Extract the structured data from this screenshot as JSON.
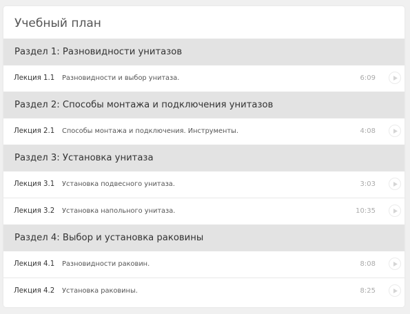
{
  "curriculum": {
    "title": "Учебный план",
    "sections": [
      {
        "title": "Раздел 1: Разновидности унитазов",
        "lectures": [
          {
            "number": "Лекция 1.1",
            "title": "Разновидности и выбор унитаза.",
            "duration": "6:09"
          }
        ]
      },
      {
        "title": "Раздел 2: Способы монтажа и подключения унитазов",
        "lectures": [
          {
            "number": "Лекция 2.1",
            "title": "Способы монтажа и подключения. Инструменты.",
            "duration": "4:08"
          }
        ]
      },
      {
        "title": "Раздел 3: Установка унитаза",
        "lectures": [
          {
            "number": "Лекция 3.1",
            "title": "Установка подвесного унитаза.",
            "duration": "3:03"
          },
          {
            "number": "Лекция 3.2",
            "title": "Установка напольного унитаза.",
            "duration": "10:35"
          }
        ]
      },
      {
        "title": "Раздел 4: Выбор и установка раковины",
        "lectures": [
          {
            "number": "Лекция 4.1",
            "title": "Разновидности раковин.",
            "duration": "8:08"
          },
          {
            "number": "Лекция 4.2",
            "title": "Установка раковины.",
            "duration": "8:25"
          }
        ]
      }
    ]
  },
  "icons": {
    "play": "play-icon"
  },
  "colors": {
    "section_bg": "#e3e3e3",
    "card_bg": "#ffffff",
    "page_bg": "#f0f0f0",
    "duration_text": "#aaaaaa"
  }
}
